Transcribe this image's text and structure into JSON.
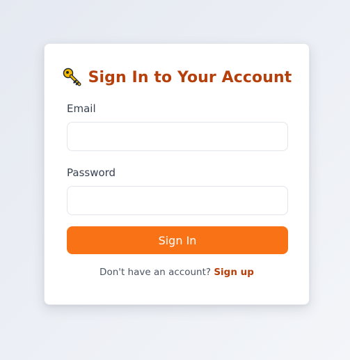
{
  "form": {
    "title": "Sign In to Your Account",
    "title_icon": "key-icon",
    "email_label": "Email",
    "email_value": "",
    "password_label": "Password",
    "password_value": "",
    "submit_label": "Sign In",
    "signup_prompt": "Don't have an account?",
    "signup_link": "Sign up"
  },
  "colors": {
    "accent": "#f97316",
    "title": "#b5400c",
    "link": "#b5400c"
  }
}
